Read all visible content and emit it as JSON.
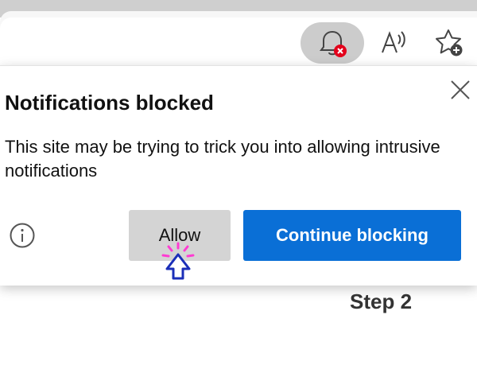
{
  "toolbar": {
    "icons": [
      "notification-blocked-bell-icon",
      "read-aloud-icon",
      "add-favorite-icon"
    ]
  },
  "popup": {
    "title": "Notifications blocked",
    "body": "This site may be trying to trick you into allowing intrusive notifications",
    "allow_label": "Allow",
    "continue_label": "Continue blocking",
    "icons": [
      "close-icon",
      "info-icon"
    ]
  },
  "annotation": {
    "step": "Step 2",
    "cursor_icon": "click-cursor-icon"
  },
  "colors": {
    "primary_button": "#0a6fd6",
    "secondary_button": "#d4d4d4",
    "blocked_badge": "#e3001b",
    "cursor_outline": "#1b2fb8",
    "click_burst": "#ff3cd2"
  }
}
